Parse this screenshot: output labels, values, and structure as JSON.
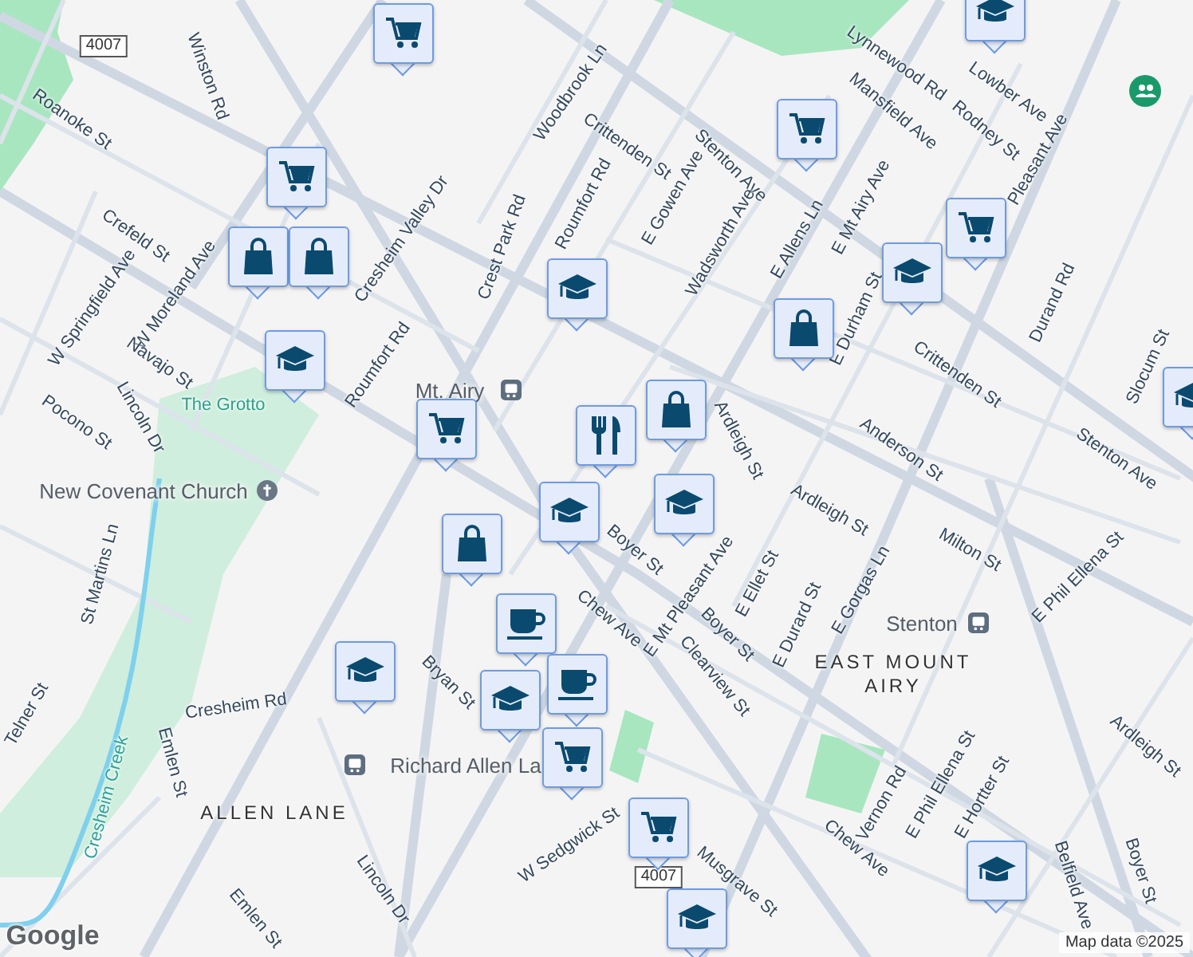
{
  "map": {
    "labels": [
      {
        "text": "4007",
        "kind": "shield"
      },
      {
        "text": "Winston Rd",
        "kind": "street"
      },
      {
        "text": "Roanoke St",
        "kind": "street"
      },
      {
        "text": "Crefeld St",
        "kind": "street"
      },
      {
        "text": "W Springfield Ave",
        "kind": "street"
      },
      {
        "text": "W Moreland Ave",
        "kind": "street"
      },
      {
        "text": "Navajo St",
        "kind": "street"
      },
      {
        "text": "Lincoln Dr",
        "kind": "street"
      },
      {
        "text": "Pocono St",
        "kind": "street"
      },
      {
        "text": "Cresheim Valley Dr",
        "kind": "street"
      },
      {
        "text": "Crest Park Rd",
        "kind": "street"
      },
      {
        "text": "Roumfort Rd",
        "kind": "street"
      },
      {
        "text": "Woodbrook Ln",
        "kind": "street"
      },
      {
        "text": "Crittenden St",
        "kind": "street"
      },
      {
        "text": "Roumfort Rd",
        "kind": "street"
      },
      {
        "text": "The Grotto",
        "kind": "park"
      },
      {
        "text": "Mt. Airy",
        "kind": "transit"
      },
      {
        "text": "New Covenant Church",
        "kind": "poi"
      },
      {
        "text": "St Martins Ln",
        "kind": "street"
      },
      {
        "text": "Cresheim Creek",
        "kind": "water"
      },
      {
        "text": "Telner St",
        "kind": "street"
      },
      {
        "text": "Emlen St",
        "kind": "street"
      },
      {
        "text": "Cresheim Rd",
        "kind": "street"
      },
      {
        "text": "Richard Allen La",
        "kind": "transit"
      },
      {
        "text": "ALLEN LANE",
        "kind": "area"
      },
      {
        "text": "Bryan St",
        "kind": "street"
      },
      {
        "text": "Lincoln Dr",
        "kind": "street"
      },
      {
        "text": "Emlen St",
        "kind": "street"
      },
      {
        "text": "W Sedgwick St",
        "kind": "street"
      },
      {
        "text": "Stenton Ave",
        "kind": "street"
      },
      {
        "text": "E Gowen Ave",
        "kind": "street"
      },
      {
        "text": "Wadsworth Ave",
        "kind": "street"
      },
      {
        "text": "E Allens Ln",
        "kind": "street"
      },
      {
        "text": "E Mt Airy Ave",
        "kind": "street"
      },
      {
        "text": "Lynnewood Rd",
        "kind": "street"
      },
      {
        "text": "Mansfield Ave",
        "kind": "street"
      },
      {
        "text": "Lowber Ave",
        "kind": "street"
      },
      {
        "text": "Rodney St",
        "kind": "street"
      },
      {
        "text": "Pleasant Ave",
        "kind": "street"
      },
      {
        "text": "Durand Rd",
        "kind": "street"
      },
      {
        "text": "E Durham St",
        "kind": "street"
      },
      {
        "text": "Crittenden St",
        "kind": "street"
      },
      {
        "text": "Anderson St",
        "kind": "street"
      },
      {
        "text": "Ardleigh St",
        "kind": "street"
      },
      {
        "text": "Slocum St",
        "kind": "street"
      },
      {
        "text": "Stenton Ave",
        "kind": "street"
      },
      {
        "text": "Ardleigh St",
        "kind": "street"
      },
      {
        "text": "Milton St",
        "kind": "street"
      },
      {
        "text": "E Phil Ellena St",
        "kind": "street"
      },
      {
        "text": "Boyer St",
        "kind": "street"
      },
      {
        "text": "E Mt Pleasant Ave",
        "kind": "street"
      },
      {
        "text": "E Ellet St",
        "kind": "street"
      },
      {
        "text": "Boyer St",
        "kind": "street"
      },
      {
        "text": "E Durard St",
        "kind": "street"
      },
      {
        "text": "E Gorgas Ln",
        "kind": "street"
      },
      {
        "text": "Stenton",
        "kind": "transit"
      },
      {
        "text": "EAST MOUNT AIRY",
        "kind": "area"
      },
      {
        "text": "Clearview St",
        "kind": "street"
      },
      {
        "text": "Chew Ave",
        "kind": "street"
      },
      {
        "text": "Chew Ave",
        "kind": "street"
      },
      {
        "text": "Vernon Rd",
        "kind": "street"
      },
      {
        "text": "E Phil Ellena St",
        "kind": "street"
      },
      {
        "text": "E Hortter St",
        "kind": "street"
      },
      {
        "text": "Belfield Ave",
        "kind": "street"
      },
      {
        "text": "Ardleigh St",
        "kind": "street"
      },
      {
        "text": "Musgrave St",
        "kind": "street"
      },
      {
        "text": "Boyer St",
        "kind": "street"
      },
      {
        "text": "4007",
        "kind": "shield"
      },
      {
        "text": "Google",
        "kind": "logo"
      },
      {
        "text": "Map data ©2025",
        "kind": "attribution"
      }
    ],
    "markers": [
      {
        "kind": "cart"
      },
      {
        "kind": "cart"
      },
      {
        "kind": "school"
      },
      {
        "kind": "school"
      },
      {
        "kind": "cart"
      },
      {
        "kind": "bag"
      },
      {
        "kind": "bag"
      },
      {
        "kind": "school"
      },
      {
        "kind": "cart"
      },
      {
        "kind": "school"
      },
      {
        "kind": "cart"
      },
      {
        "kind": "school"
      },
      {
        "kind": "bag"
      },
      {
        "kind": "bag"
      },
      {
        "kind": "food"
      },
      {
        "kind": "school"
      },
      {
        "kind": "school"
      },
      {
        "kind": "bag"
      },
      {
        "kind": "coffee"
      },
      {
        "kind": "coffee"
      },
      {
        "kind": "school"
      },
      {
        "kind": "school"
      },
      {
        "kind": "cart"
      },
      {
        "kind": "cart"
      },
      {
        "kind": "school"
      },
      {
        "kind": "school"
      }
    ]
  }
}
